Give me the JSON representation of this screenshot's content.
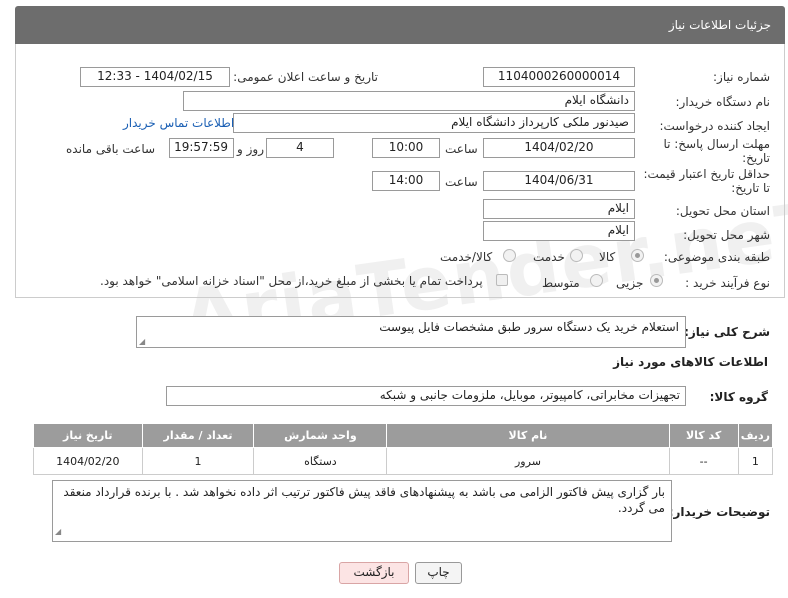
{
  "header": {
    "title": "جزئیات اطلاعات نیاز"
  },
  "fields": {
    "need_number_label": "شماره نیاز:",
    "need_number": "1104000260000014",
    "announce_label": "تاریخ و ساعت اعلان عمومی:",
    "announce_value": "1404/02/15 - 12:33",
    "buyer_org_label": "نام دستگاه خریدار:",
    "buyer_org": "دانشگاه ایلام",
    "creator_label": "ایجاد کننده درخواست:",
    "creator": "صیدنور ملکی کارپرداز دانشگاه ایلام",
    "contact_link": "اطلاعات تماس خریدار",
    "deadline_label_1": "مهلت ارسال پاسخ: تا",
    "deadline_label_2": "تاریخ:",
    "deadline_date": "1404/02/20",
    "time_label": "ساعت",
    "deadline_time": "10:00",
    "days_value": "4",
    "days_label": "روز و",
    "remaining_time": "19:57:59",
    "remaining_label": "ساعت باقی مانده",
    "validity_label_1": "حداقل تاریخ اعتبار قیمت:",
    "validity_label_2": "تا تاریخ:",
    "validity_date": "1404/06/31",
    "validity_time": "14:00",
    "province_label": "استان محل تحویل:",
    "province": "ایلام",
    "city_label": "شهر محل تحویل:",
    "city": "ایلام",
    "category_label": "طبقه بندی موضوعی:",
    "category_options": [
      "کالا",
      "خدمت",
      "کالا/خدمت"
    ],
    "process_label": "نوع فرآیند خرید :",
    "process_options": [
      "جزیی",
      "متوسط"
    ],
    "payment_note": "پرداخت تمام یا بخشی از مبلغ خرید،از محل \"اسناد خزانه اسلامی\" خواهد بود."
  },
  "summary": {
    "label": "شرح کلی نیاز:",
    "text": "استعلام خرید یک دستگاه سرور طبق مشخصات فایل پیوست"
  },
  "goods_section": {
    "title": "اطلاعات کالاهای مورد نیاز",
    "group_label": "گروه کالا:",
    "group_value": "تجهیزات مخابراتی، کامپیوتر، موبایل، ملزومات جانبی و شبکه"
  },
  "table": {
    "headers": [
      "ردیف",
      "کد کالا",
      "نام کالا",
      "واحد شمارش",
      "تعداد / مقدار",
      "تاریخ نیاز"
    ],
    "rows": [
      [
        "1",
        "--",
        "سرور",
        "دستگاه",
        "1",
        "1404/02/20"
      ]
    ]
  },
  "notes": {
    "label": "توضیحات خریدار:",
    "text": "بار گزاری پیش فاکتور الزامی می باشد به پیشنهادهای فاقد پیش فاکتور ترتیب اثر داده نخواهد شد . با برنده قرارداد منعقد می گردد."
  },
  "buttons": {
    "print": "چاپ",
    "back": "بازگشت"
  },
  "watermark": "AriaTender.neT"
}
